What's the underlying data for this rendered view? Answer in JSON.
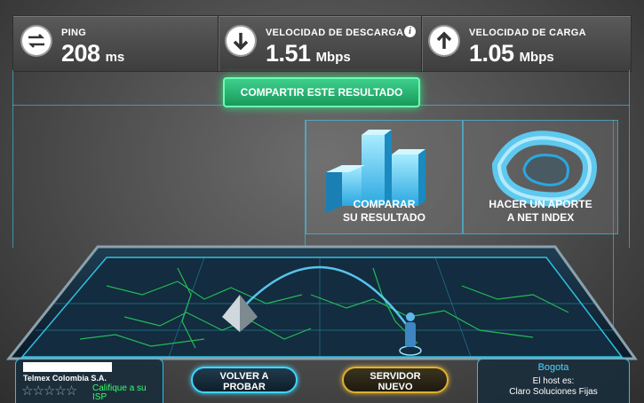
{
  "stats": {
    "ping": {
      "label": "PING",
      "value": "208",
      "unit": "ms"
    },
    "download": {
      "label": "VELOCIDAD DE DESCARGA",
      "value": "1.51",
      "unit": "Mbps"
    },
    "upload": {
      "label": "VELOCIDAD DE CARGA",
      "value": "1.05",
      "unit": "Mbps"
    }
  },
  "share_button": "COMPARTIR ESTE RESULTADO",
  "panels": {
    "compare": {
      "line1": "COMPARAR",
      "line2": "SU RESULTADO"
    },
    "contribute": {
      "line1": "HACER UN APORTE",
      "line2": "A NET INDEX"
    }
  },
  "isp": {
    "name": "Telmex Colombia S.A.",
    "rate_line1": "Califique a su",
    "rate_line2": "ISP"
  },
  "buttons": {
    "retest": {
      "line1": "VOLVER A",
      "line2": "PROBAR"
    },
    "new_server": {
      "line1": "SERVIDOR",
      "line2": "NUEVO"
    }
  },
  "host": {
    "city": "Bogota",
    "label": "El host es:",
    "name": "Claro Soluciones Fijas"
  },
  "colors": {
    "accent": "#3fd6ff",
    "share_green": "#2fe07f",
    "server_gold": "#e0b030"
  }
}
